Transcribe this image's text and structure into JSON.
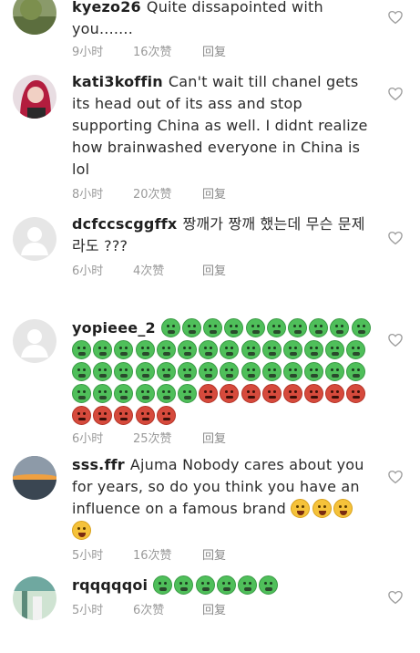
{
  "comments": [
    {
      "username": "kyezo26",
      "text": "Quite dissapointed with you.......",
      "time": "9小时",
      "likes": "16次赞",
      "reply": "回复"
    },
    {
      "username": "kati3koffin",
      "text": "Can't wait till chanel gets its head out of its ass and stop supporting China as well. I didnt realize how brainwashed everyone in China is lol",
      "time": "8小时",
      "likes": "20次赞",
      "reply": "回复"
    },
    {
      "username": "dcfccscggffx",
      "text": "짱깨가 짱깨 했는데 무슨 문제라도 ???",
      "time": "6小时",
      "likes": "4次赞",
      "reply": "回复"
    },
    {
      "username": "yopieee_2",
      "text": "",
      "emoji": {
        "sick_count": 44,
        "angry_count": 13
      },
      "time": "6小时",
      "likes": "25次赞",
      "reply": "回复"
    },
    {
      "username": "sss.ffr",
      "text": "Ajuma Nobody cares about you for years, so do you think you have an influence on a famous brand",
      "emoji": {
        "laugh_count": 4
      },
      "time": "5小时",
      "likes": "16次赞",
      "reply": "回复"
    },
    {
      "username": "rqqqqqoi",
      "text": "",
      "emoji": {
        "sick_count": 6
      },
      "time": "5小时",
      "likes": "6次赞",
      "reply": "回复"
    }
  ],
  "icons": {
    "like": "heart-outline-icon"
  },
  "colors": {
    "meta": "#9a9a9a",
    "heart": "#9c9c9c"
  }
}
